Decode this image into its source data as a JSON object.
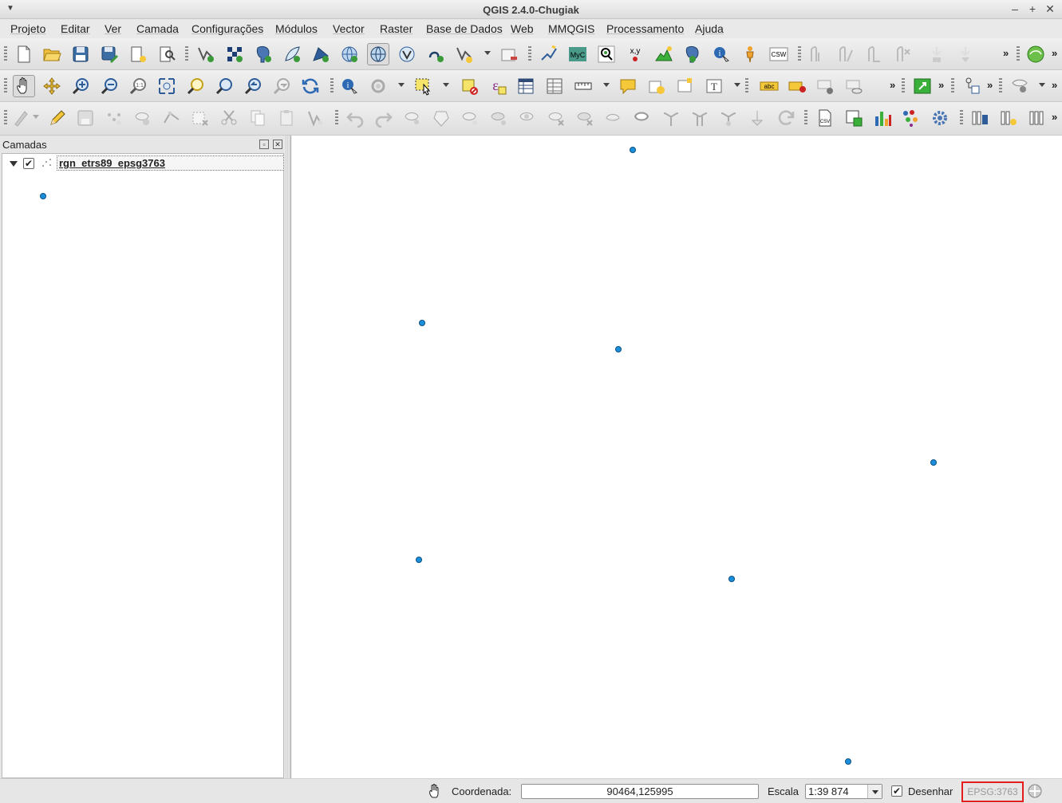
{
  "window": {
    "title": "QGIS 2.4.0-Chugiak",
    "minimize": "–",
    "maximize": "+",
    "close": "✕"
  },
  "menu": [
    "Projeto",
    "Editar",
    "Ver",
    "Camada",
    "Configurações",
    "Módulos",
    "Vector",
    "Raster",
    "Base de Dados",
    "Web",
    "MMQGIS",
    "Processamento",
    "Ajuda"
  ],
  "toolbar_labels": {
    "myc": "MyC",
    "xy": "x,y",
    "csw": "CSW",
    "more": "»",
    "abc": "abc",
    "epsilon": "ε",
    "csv": "CSV"
  },
  "layers_panel": {
    "title": "Camadas",
    "float_icon": "▫",
    "close_icon": "✕",
    "layers": [
      {
        "name": "rgn_etrs89_epsg3763",
        "visible": true,
        "check": "✔"
      }
    ]
  },
  "map": {
    "point_color": "#1a8fdc"
  },
  "status": {
    "coord_label": "Coordenada:",
    "coord_value": "90464,125995",
    "scale_label": "Escala",
    "scale_value": "1:39 874",
    "render_label": "Desenhar",
    "render_checked": "✔",
    "crs": "EPSG:3763"
  },
  "icons": {
    "toolbar1": [
      "new-project-icon",
      "open-project-icon",
      "save-project-icon",
      "save-as-icon",
      "new-print-composer-icon",
      "composer-manager-icon",
      "add-vector-layer-icon",
      "add-raster-layer-icon",
      "add-postgis-layer-icon",
      "add-spatialite-layer-icon",
      "add-mssql-layer-icon",
      "add-wms-layer-icon",
      "add-wcs-layer-icon",
      "add-wfs-layer-icon",
      "add-delimited-text-icon",
      "new-vector-layer-icon",
      "remove-layer-icon",
      "georeferencer-icon",
      "myc-icon",
      "zoom-to-point-icon",
      "xy-tools-icon",
      "profile-icon",
      "gps-tools-icon",
      "identify-icon",
      "street-view-icon",
      "csw-icon",
      "measure-icon",
      "measure-area-icon",
      "measure-angle-icon",
      "measure-line-icon",
      "gps-icon",
      "gps-down-icon",
      "openlayers-icon"
    ]
  }
}
